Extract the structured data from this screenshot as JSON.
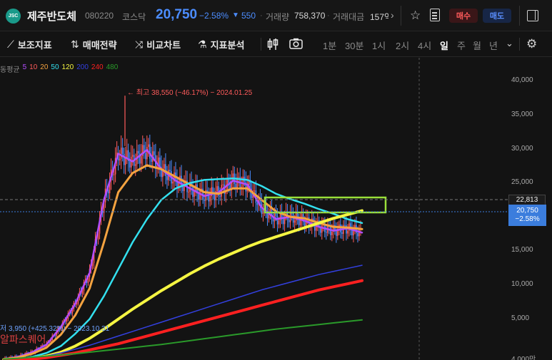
{
  "header": {
    "logo_text": "JSC",
    "stock_name": "제주반도체",
    "stock_code": "080220",
    "market": "코스닥",
    "price": "20,750",
    "change_pct": "−2.58%",
    "change_arrow": "▼",
    "change_abs": "550",
    "volume_label": "거래량",
    "volume_value": "758,370",
    "amount_label": "거래대금",
    "amount_value": "157억",
    "more": "›",
    "buy": "매수",
    "sell": "매도"
  },
  "toolbar": {
    "indicator": "보조지표",
    "strategy": "매매전략",
    "compare": "비교차트",
    "analysis": "지표분석",
    "periods": [
      "1분",
      "30분",
      "1시",
      "2시",
      "4시",
      "일",
      "주",
      "월",
      "년"
    ],
    "active_period": "일",
    "more": "⌄"
  },
  "chart": {
    "ma_label": "동평균",
    "ma_periods": [
      {
        "label": "5",
        "color": "#b44dff"
      },
      {
        "label": "10",
        "color": "#ff5b5b"
      },
      {
        "label": "20",
        "color": "#f4a340"
      },
      {
        "label": "50",
        "color": "#33e0ef"
      },
      {
        "label": "120",
        "color": "#f5f542"
      },
      {
        "label": "200",
        "color": "#3340e0"
      },
      {
        "label": "240",
        "color": "#ff2020"
      },
      {
        "label": "480",
        "color": "#2a9a2a"
      }
    ],
    "high_label": "← 최고 38,550 (−46.17%) − 2024.01.25",
    "low_label": "저 3,950 (+425.32%) − 2023.10.31",
    "watermark": "알파스퀘어",
    "y_ticks": [
      "40,000",
      "35,000",
      "30,000",
      "25,000",
      "20,",
      "15,000",
      "10,000",
      "5,000",
      "4,000만"
    ],
    "ref_price": "22,813",
    "cur_price": "20,750",
    "cur_change": "−2.58%",
    "up_color": "#ff5b5b",
    "down_color": "#4c8dff"
  },
  "chart_data": {
    "type": "line",
    "title": "",
    "xlabel": "",
    "ylabel": "",
    "ylim": [
      4000,
      42000
    ],
    "x": [
      0,
      10,
      20,
      30,
      40,
      50,
      60,
      70,
      80,
      90,
      100,
      110,
      120,
      130,
      140,
      150,
      160,
      170,
      180,
      190,
      200,
      210,
      220,
      230,
      240,
      250
    ],
    "series": [
      {
        "values": [
          4300,
          4600,
          5200,
          6200,
          8500,
          11500,
          15500,
          25000,
          31000,
          30000,
          31500,
          29000,
          27500,
          26500,
          25500,
          26000,
          27500,
          27000,
          24000,
          22500,
          22800,
          22300,
          21500,
          21000,
          21300,
          20750
        ]
      },
      {
        "values": [
          4300,
          4500,
          5000,
          5800,
          7500,
          10000,
          13500,
          19500,
          26000,
          28500,
          29500,
          29000,
          28000,
          27000,
          26000,
          25800,
          26500,
          26500,
          25000,
          23500,
          22800,
          22600,
          22000,
          21500,
          21400,
          21200
        ]
      },
      {
        "values": [
          4200,
          4300,
          4600,
          5100,
          6000,
          7600,
          9500,
          12500,
          16000,
          19500,
          22500,
          25000,
          26500,
          27200,
          27600,
          27700,
          27800,
          27600,
          26800,
          25800,
          25100,
          24500,
          23800,
          23200,
          22500,
          22000
        ]
      },
      {
        "values": [
          4200,
          4250,
          4400,
          4700,
          5200,
          6000,
          7000,
          8200,
          9500,
          10800,
          12000,
          13200,
          14300,
          15400,
          16400,
          17300,
          18100,
          18900,
          19600,
          20200,
          20800,
          21400,
          22000,
          22600,
          23100,
          23600
        ]
      },
      {
        "values": [
          4100,
          4200,
          4400,
          4700,
          5100,
          5600,
          6100,
          6700,
          7300,
          7900,
          8500,
          9100,
          9700,
          10300,
          10900,
          11500,
          12100,
          12700,
          13300,
          13800,
          14300,
          14800,
          15300,
          15700,
          16100,
          16500
        ]
      },
      {
        "values": [
          4100,
          4150,
          4300,
          4500,
          4800,
          5100,
          5500,
          5900,
          6300,
          6800,
          7300,
          7800,
          8300,
          8800,
          9300,
          9800,
          10300,
          10800,
          11300,
          11800,
          12300,
          12800,
          13300,
          13700,
          14100,
          14500
        ]
      },
      {
        "values": [
          4300,
          4400,
          4550,
          4700,
          4850,
          5000,
          5200,
          5400,
          5600,
          5800,
          6000,
          6200,
          6450,
          6700,
          6950,
          7200,
          7450,
          7700,
          7950,
          8200,
          8400,
          8600,
          8800,
          9000,
          9200,
          9400
        ]
      }
    ]
  }
}
